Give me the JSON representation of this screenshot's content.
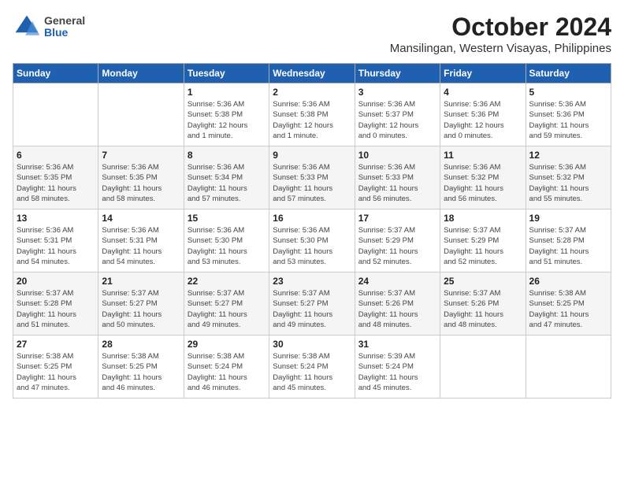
{
  "header": {
    "logo_general": "General",
    "logo_blue": "Blue",
    "month": "October 2024",
    "location": "Mansilingan, Western Visayas, Philippines"
  },
  "weekdays": [
    "Sunday",
    "Monday",
    "Tuesday",
    "Wednesday",
    "Thursday",
    "Friday",
    "Saturday"
  ],
  "weeks": [
    [
      {
        "day": "",
        "info": ""
      },
      {
        "day": "",
        "info": ""
      },
      {
        "day": "1",
        "info": "Sunrise: 5:36 AM\nSunset: 5:38 PM\nDaylight: 12 hours\nand 1 minute."
      },
      {
        "day": "2",
        "info": "Sunrise: 5:36 AM\nSunset: 5:38 PM\nDaylight: 12 hours\nand 1 minute."
      },
      {
        "day": "3",
        "info": "Sunrise: 5:36 AM\nSunset: 5:37 PM\nDaylight: 12 hours\nand 0 minutes."
      },
      {
        "day": "4",
        "info": "Sunrise: 5:36 AM\nSunset: 5:36 PM\nDaylight: 12 hours\nand 0 minutes."
      },
      {
        "day": "5",
        "info": "Sunrise: 5:36 AM\nSunset: 5:36 PM\nDaylight: 11 hours\nand 59 minutes."
      }
    ],
    [
      {
        "day": "6",
        "info": "Sunrise: 5:36 AM\nSunset: 5:35 PM\nDaylight: 11 hours\nand 58 minutes."
      },
      {
        "day": "7",
        "info": "Sunrise: 5:36 AM\nSunset: 5:35 PM\nDaylight: 11 hours\nand 58 minutes."
      },
      {
        "day": "8",
        "info": "Sunrise: 5:36 AM\nSunset: 5:34 PM\nDaylight: 11 hours\nand 57 minutes."
      },
      {
        "day": "9",
        "info": "Sunrise: 5:36 AM\nSunset: 5:33 PM\nDaylight: 11 hours\nand 57 minutes."
      },
      {
        "day": "10",
        "info": "Sunrise: 5:36 AM\nSunset: 5:33 PM\nDaylight: 11 hours\nand 56 minutes."
      },
      {
        "day": "11",
        "info": "Sunrise: 5:36 AM\nSunset: 5:32 PM\nDaylight: 11 hours\nand 56 minutes."
      },
      {
        "day": "12",
        "info": "Sunrise: 5:36 AM\nSunset: 5:32 PM\nDaylight: 11 hours\nand 55 minutes."
      }
    ],
    [
      {
        "day": "13",
        "info": "Sunrise: 5:36 AM\nSunset: 5:31 PM\nDaylight: 11 hours\nand 54 minutes."
      },
      {
        "day": "14",
        "info": "Sunrise: 5:36 AM\nSunset: 5:31 PM\nDaylight: 11 hours\nand 54 minutes."
      },
      {
        "day": "15",
        "info": "Sunrise: 5:36 AM\nSunset: 5:30 PM\nDaylight: 11 hours\nand 53 minutes."
      },
      {
        "day": "16",
        "info": "Sunrise: 5:36 AM\nSunset: 5:30 PM\nDaylight: 11 hours\nand 53 minutes."
      },
      {
        "day": "17",
        "info": "Sunrise: 5:37 AM\nSunset: 5:29 PM\nDaylight: 11 hours\nand 52 minutes."
      },
      {
        "day": "18",
        "info": "Sunrise: 5:37 AM\nSunset: 5:29 PM\nDaylight: 11 hours\nand 52 minutes."
      },
      {
        "day": "19",
        "info": "Sunrise: 5:37 AM\nSunset: 5:28 PM\nDaylight: 11 hours\nand 51 minutes."
      }
    ],
    [
      {
        "day": "20",
        "info": "Sunrise: 5:37 AM\nSunset: 5:28 PM\nDaylight: 11 hours\nand 51 minutes."
      },
      {
        "day": "21",
        "info": "Sunrise: 5:37 AM\nSunset: 5:27 PM\nDaylight: 11 hours\nand 50 minutes."
      },
      {
        "day": "22",
        "info": "Sunrise: 5:37 AM\nSunset: 5:27 PM\nDaylight: 11 hours\nand 49 minutes."
      },
      {
        "day": "23",
        "info": "Sunrise: 5:37 AM\nSunset: 5:27 PM\nDaylight: 11 hours\nand 49 minutes."
      },
      {
        "day": "24",
        "info": "Sunrise: 5:37 AM\nSunset: 5:26 PM\nDaylight: 11 hours\nand 48 minutes."
      },
      {
        "day": "25",
        "info": "Sunrise: 5:37 AM\nSunset: 5:26 PM\nDaylight: 11 hours\nand 48 minutes."
      },
      {
        "day": "26",
        "info": "Sunrise: 5:38 AM\nSunset: 5:25 PM\nDaylight: 11 hours\nand 47 minutes."
      }
    ],
    [
      {
        "day": "27",
        "info": "Sunrise: 5:38 AM\nSunset: 5:25 PM\nDaylight: 11 hours\nand 47 minutes."
      },
      {
        "day": "28",
        "info": "Sunrise: 5:38 AM\nSunset: 5:25 PM\nDaylight: 11 hours\nand 46 minutes."
      },
      {
        "day": "29",
        "info": "Sunrise: 5:38 AM\nSunset: 5:24 PM\nDaylight: 11 hours\nand 46 minutes."
      },
      {
        "day": "30",
        "info": "Sunrise: 5:38 AM\nSunset: 5:24 PM\nDaylight: 11 hours\nand 45 minutes."
      },
      {
        "day": "31",
        "info": "Sunrise: 5:39 AM\nSunset: 5:24 PM\nDaylight: 11 hours\nand 45 minutes."
      },
      {
        "day": "",
        "info": ""
      },
      {
        "day": "",
        "info": ""
      }
    ]
  ]
}
